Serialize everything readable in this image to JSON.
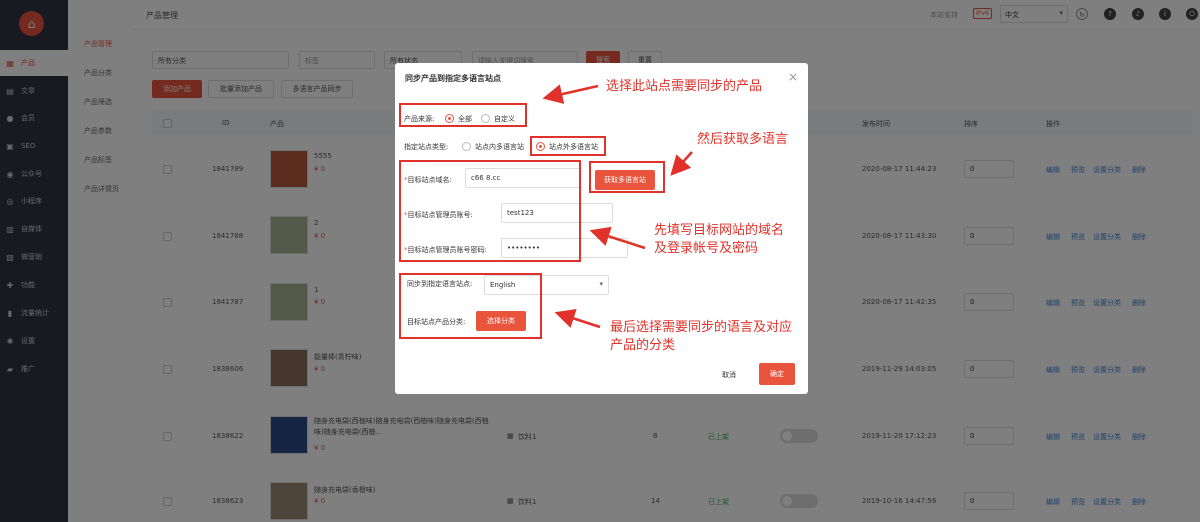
{
  "sidebar": {
    "items": [
      {
        "label": "产品",
        "icon": "grid-icon"
      },
      {
        "label": "文章",
        "icon": "doc-icon"
      },
      {
        "label": "会员",
        "icon": "user-icon"
      },
      {
        "label": "SEO",
        "icon": "seo-icon"
      },
      {
        "label": "公众号",
        "icon": "wechat-icon"
      },
      {
        "label": "小程序",
        "icon": "miniapp-icon"
      },
      {
        "label": "自媒体",
        "icon": "media-icon"
      },
      {
        "label": "微营销",
        "icon": "marketing-icon"
      },
      {
        "label": "功能",
        "icon": "function-icon"
      },
      {
        "label": "流量统计",
        "icon": "chart-icon"
      },
      {
        "label": "设置",
        "icon": "gear-icon"
      },
      {
        "label": "推广",
        "icon": "promo-icon"
      }
    ]
  },
  "subnav": {
    "items": [
      "产品管理",
      "产品分类",
      "产品筛选",
      "产品参数",
      "产品标签",
      "产品详情页"
    ]
  },
  "topbar": {
    "breadcrumb": "产品管理",
    "support": "本站支持",
    "ipv6": "IPv6",
    "language": "中文"
  },
  "filters": {
    "category": "所有分类",
    "tag": "标签",
    "status": "所有状态",
    "keyword_placeholder": "请输入关键词搜索",
    "search": "搜索",
    "reset": "重置"
  },
  "toolbar": {
    "add": "添加产品",
    "batch_add": "批量添加产品",
    "sync": "多语言产品同步"
  },
  "table": {
    "headers": {
      "id": "ID",
      "product": "产品",
      "publish_time": "发布时间",
      "sort": "排序",
      "action": "操作"
    },
    "actions": [
      "编辑",
      "预览",
      "设置分类",
      "删除"
    ],
    "rows": [
      {
        "id": "1841789",
        "name": "5555",
        "price": "¥ 0",
        "time": "2020-08-17 11:44:23",
        "sort": "0"
      },
      {
        "id": "1841788",
        "name": "2",
        "price": "¥ 0",
        "time": "2020-08-17 11:43:30",
        "sort": "0"
      },
      {
        "id": "1841787",
        "name": "1",
        "price": "¥ 0",
        "time": "2020-08-17 11:42:35",
        "sort": "0"
      },
      {
        "id": "1838606",
        "name": "能量棒(青柠味)",
        "price": "¥ 0",
        "time": "2019-11-29 14:03:05",
        "sort": "0"
      },
      {
        "id": "1838622",
        "name": "随身充电袋(西柚味)随身充电袋(西柚味)随身充电袋(西柚味)随身充电袋(西柚...",
        "price": "¥ 0",
        "category": "饮料1",
        "count": "8",
        "status": "已上架",
        "time": "2019-11-20 17:12:23",
        "sort": "0"
      },
      {
        "id": "1838623",
        "name": "随身充电袋(香橙味)",
        "price": "¥ 0",
        "category": "饮料1",
        "count": "14",
        "status": "已上架",
        "time": "2019-10-16 14:47:56",
        "sort": "0"
      }
    ]
  },
  "modal": {
    "title": "同步产品到指定多语言站点",
    "source_label": "产品来源:",
    "source_all": "全部",
    "source_custom": "自定义",
    "site_type_label": "指定站点类型:",
    "site_inner": "站点内多语言站",
    "site_outer": "站点外多语言站",
    "domain_label": "目标站点域名:",
    "domain_value": "c66          8.cc",
    "fetch_button": "获取多语言站",
    "account_label": "目标站点管理员账号:",
    "account_value": "test123",
    "password_label": "目标站点管理员账号密码:",
    "password_value": "••••••••",
    "sync_lang_label": "同步到指定语言站点:",
    "sync_lang_value": "English",
    "category_label": "目标站点产品分类:",
    "category_button": "选择分类",
    "cancel": "取消",
    "confirm": "确定"
  },
  "annotations": {
    "a1": "选择此站点需要同步的产品",
    "a2": "然后获取多语言",
    "a3": "先填写目标网站的域名\n及登录帐号及密码",
    "a4": "最后选择需要同步的语言及对应\n产品的分类"
  },
  "colors": {
    "accent": "#e9543c",
    "sidebar": "#2f3440",
    "annotation": "#e0322a"
  }
}
